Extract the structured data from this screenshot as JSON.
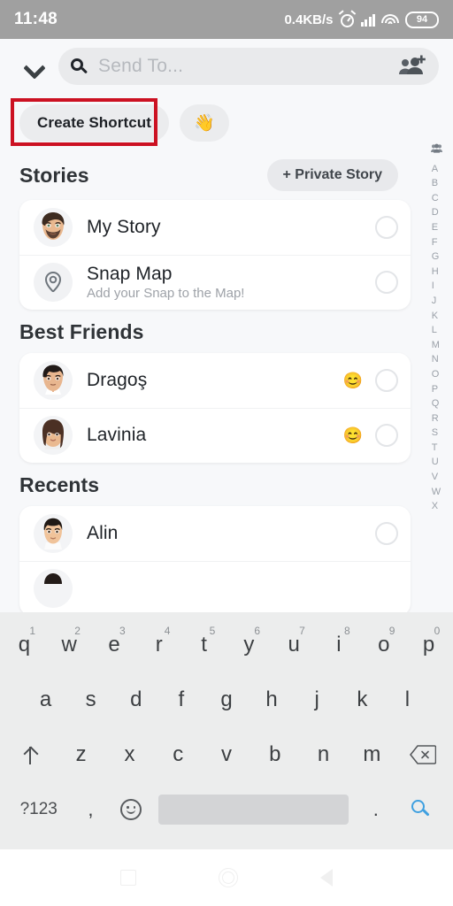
{
  "statusbar": {
    "time": "11:48",
    "network_speed": "0.4KB/s",
    "alarm_icon": "alarm-clock-icon",
    "signal_icon": "cellular-signal-icon",
    "wifi_icon": "wifi-icon",
    "battery_level": "94"
  },
  "header": {
    "collapse_icon": "chevron-down-icon",
    "search_icon": "search-icon",
    "search_value": "",
    "search_placeholder": "Send To...",
    "add_group_icon": "add-group-icon"
  },
  "actions": {
    "create_shortcut_label": "Create Shortcut",
    "wave_emoji": "👋",
    "highlight_color": "#cc1122"
  },
  "sections": [
    {
      "title": "Stories",
      "action_label": "+ Private Story",
      "rows": [
        {
          "title": "My Story",
          "subtitle": "",
          "emoji": "",
          "avatar": "bitmoji-bearded-man",
          "selected": false
        },
        {
          "title": "Snap Map",
          "subtitle": "Add your Snap to the Map!",
          "emoji": "",
          "avatar": "location-pin-icon",
          "selected": false
        }
      ]
    },
    {
      "title": "Best Friends",
      "action_label": "",
      "rows": [
        {
          "title": "Dragoş",
          "subtitle": "",
          "emoji": "😊",
          "avatar": "bitmoji-dark-hair-man",
          "selected": false
        },
        {
          "title": "Lavinia",
          "subtitle": "",
          "emoji": "😊",
          "avatar": "bitmoji-long-hair-woman",
          "selected": false
        }
      ]
    },
    {
      "title": "Recents",
      "action_label": "",
      "rows": [
        {
          "title": "Alin",
          "subtitle": "",
          "emoji": "",
          "avatar": "bitmoji-young-man",
          "selected": false
        }
      ]
    }
  ],
  "alpha_index": {
    "group_icon": "group-icon",
    "letters": [
      "A",
      "B",
      "C",
      "D",
      "E",
      "F",
      "G",
      "H",
      "I",
      "J",
      "K",
      "L",
      "M",
      "N",
      "O",
      "P",
      "Q",
      "R",
      "S",
      "T",
      "U",
      "V",
      "W",
      "X"
    ]
  },
  "keyboard": {
    "row1": [
      {
        "key": "q",
        "num": "1"
      },
      {
        "key": "w",
        "num": "2"
      },
      {
        "key": "e",
        "num": "3"
      },
      {
        "key": "r",
        "num": "4"
      },
      {
        "key": "t",
        "num": "5"
      },
      {
        "key": "y",
        "num": "6"
      },
      {
        "key": "u",
        "num": "7"
      },
      {
        "key": "i",
        "num": "8"
      },
      {
        "key": "o",
        "num": "9"
      },
      {
        "key": "p",
        "num": "0"
      }
    ],
    "row2": [
      "a",
      "s",
      "d",
      "f",
      "g",
      "h",
      "j",
      "k",
      "l"
    ],
    "row3": [
      "z",
      "x",
      "c",
      "v",
      "b",
      "n",
      "m"
    ],
    "shift_icon": "shift-icon",
    "backspace_icon": "backspace-icon",
    "symbols_label": "?123",
    "comma_label": ",",
    "emoji_icon": "emoji-icon",
    "space_label": "",
    "period_label": ".",
    "search_key_icon": "search-icon"
  },
  "navbar": {
    "recents_icon": "recents-square-icon",
    "home_icon": "home-circle-icon",
    "back_icon": "back-triangle-icon"
  }
}
